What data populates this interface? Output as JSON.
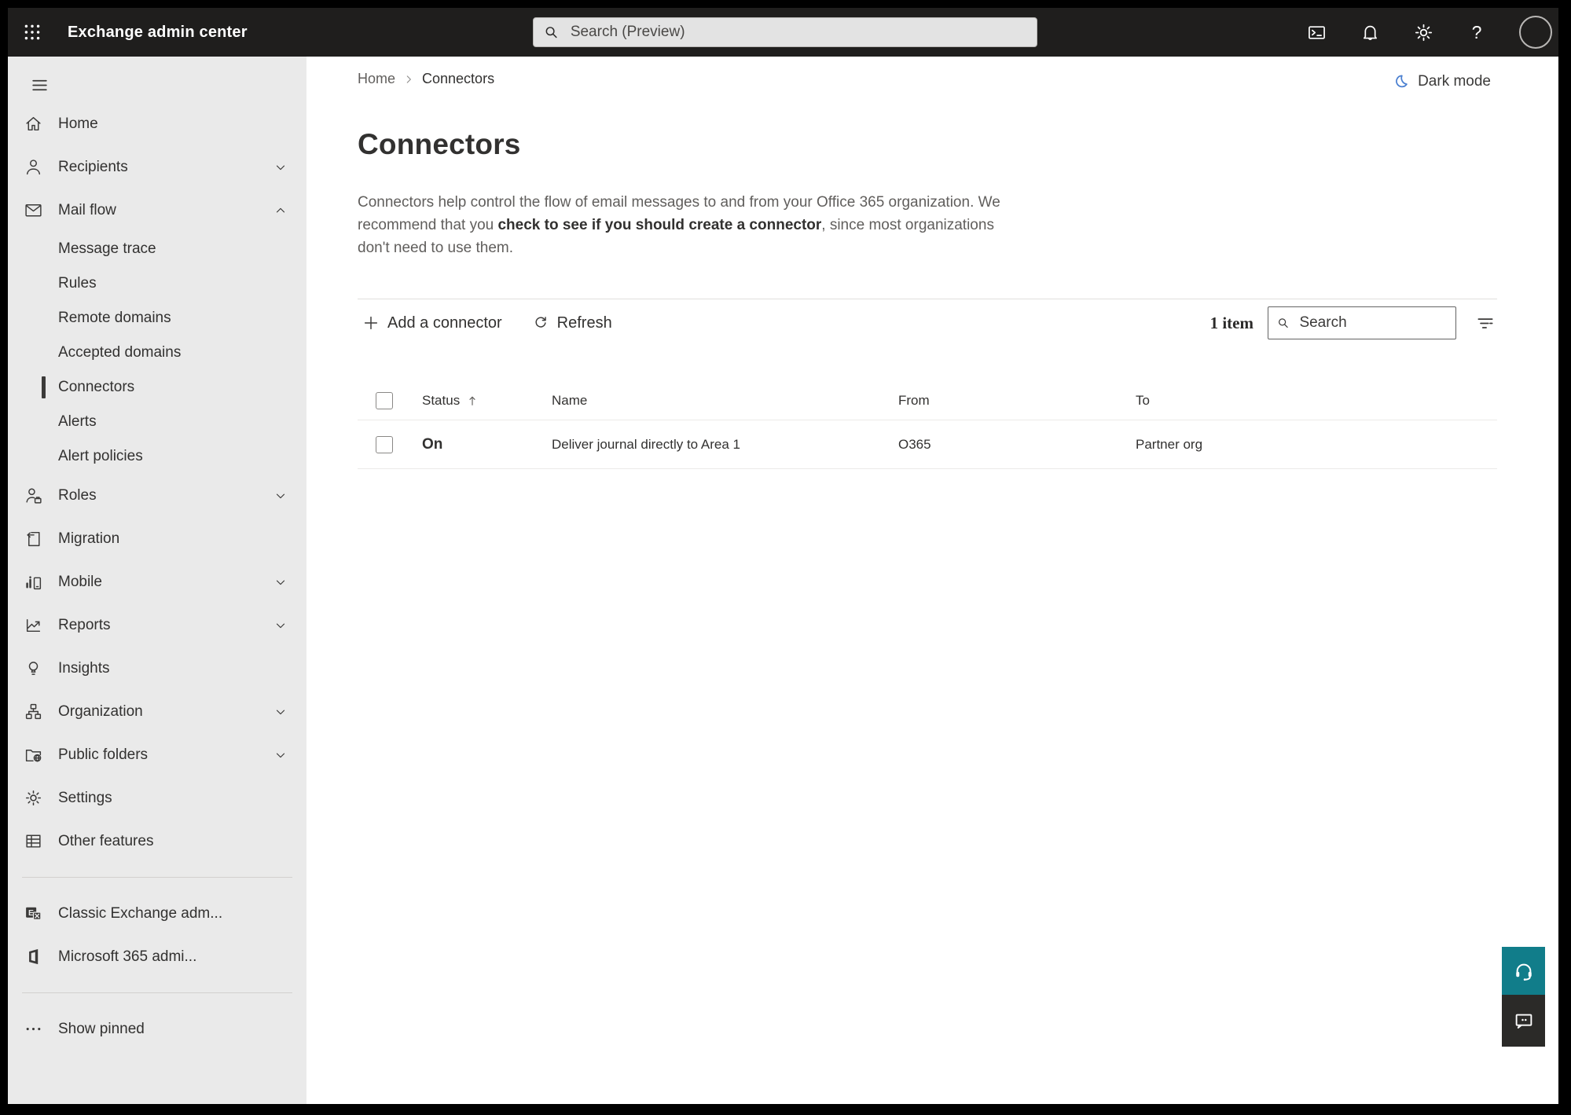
{
  "topbar": {
    "app_title": "Exchange admin center",
    "search_placeholder": "Search (Preview)"
  },
  "sidebar": {
    "items": [
      {
        "label": "Home"
      },
      {
        "label": "Recipients"
      },
      {
        "label": "Mail flow"
      },
      {
        "label": "Message trace"
      },
      {
        "label": "Rules"
      },
      {
        "label": "Remote domains"
      },
      {
        "label": "Accepted domains"
      },
      {
        "label": "Connectors"
      },
      {
        "label": "Alerts"
      },
      {
        "label": "Alert policies"
      },
      {
        "label": "Roles"
      },
      {
        "label": "Migration"
      },
      {
        "label": "Mobile"
      },
      {
        "label": "Reports"
      },
      {
        "label": "Insights"
      },
      {
        "label": "Organization"
      },
      {
        "label": "Public folders"
      },
      {
        "label": "Settings"
      },
      {
        "label": "Other features"
      },
      {
        "label": "Classic Exchange adm..."
      },
      {
        "label": "Microsoft 365 admi..."
      },
      {
        "label": "Show pinned"
      }
    ]
  },
  "breadcrumb": {
    "home": "Home",
    "current": "Connectors"
  },
  "dark_mode_label": "Dark mode",
  "page": {
    "title": "Connectors",
    "description_part1": "Connectors help control the flow of email messages to and from your Office 365 organization. We recommend that you ",
    "description_bold": "check to see if you should create a connector",
    "description_part2": ", since most organizations don't need to use them."
  },
  "toolbar": {
    "add_label": "Add a connector",
    "refresh_label": "Refresh",
    "item_count": "1 item",
    "search_placeholder": "Search"
  },
  "table": {
    "headers": {
      "status": "Status",
      "name": "Name",
      "from": "From",
      "to": "To"
    },
    "rows": [
      {
        "status": "On",
        "name": "Deliver journal directly to Area 1",
        "from": "O365",
        "to": "Partner org"
      }
    ]
  },
  "colors": {
    "topbar_bg": "#1f1e1d",
    "sidebar_bg": "#eaeaea",
    "selected_indicator": "#3b3a39",
    "moon_blue": "#4a7fd0",
    "support_teal": "#117d8a",
    "feedback_dark": "#2b2a28"
  }
}
